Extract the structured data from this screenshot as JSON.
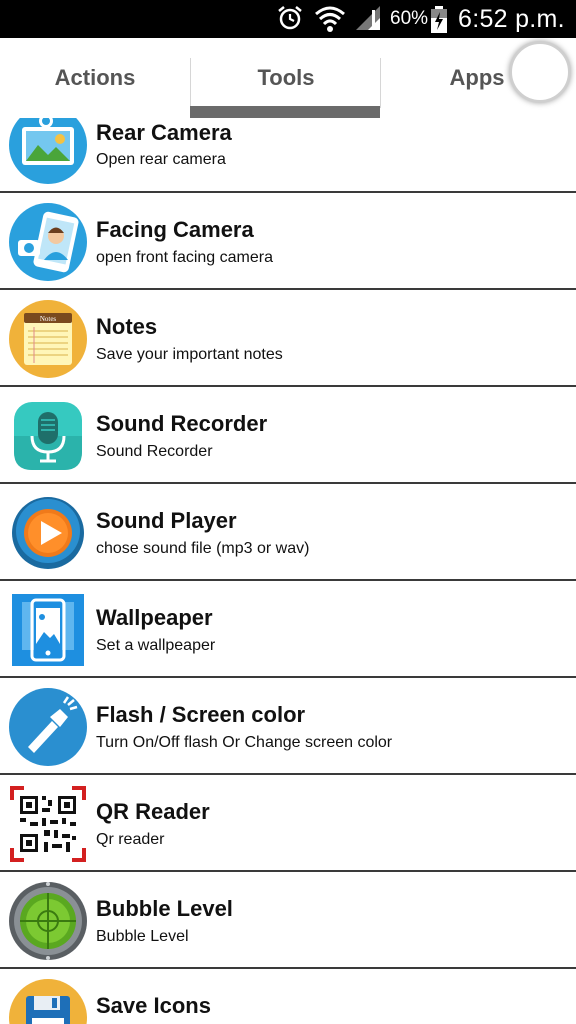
{
  "status_bar": {
    "battery_percent": "60%",
    "time": "6:52 p.m.",
    "icons": [
      "alarm-icon",
      "wifi-icon",
      "signal-icon",
      "battery-charging-icon"
    ]
  },
  "tabs": [
    {
      "label": "Actions",
      "selected": false
    },
    {
      "label": "Tools",
      "selected": true
    },
    {
      "label": "Apps",
      "selected": false
    }
  ],
  "colors": {
    "tab_indicator": "#6b6b6b",
    "icon_blue": "#2aa0dd",
    "notes_yellow": "#f0b23a"
  },
  "items": [
    {
      "title": "Rear Camera",
      "subtitle": "Open rear camera",
      "icon": "rear-camera-icon"
    },
    {
      "title": "Facing Camera",
      "subtitle": "open front facing camera",
      "icon": "facing-camera-icon"
    },
    {
      "title": "Notes",
      "subtitle": "Save your important notes",
      "icon": "notes-icon"
    },
    {
      "title": "Sound Recorder",
      "subtitle": "Sound Recorder",
      "icon": "microphone-icon"
    },
    {
      "title": "Sound Player",
      "subtitle": "chose sound file (mp3 or wav)",
      "icon": "play-icon"
    },
    {
      "title": "Wallpeaper",
      "subtitle": "Set a wallpeaper",
      "icon": "wallpaper-icon"
    },
    {
      "title": "Flash / Screen color",
      "subtitle": "Turn On/Off flash Or Change screen color",
      "icon": "flashlight-icon"
    },
    {
      "title": "QR Reader",
      "subtitle": "Qr reader",
      "icon": "qr-code-icon"
    },
    {
      "title": "Bubble Level",
      "subtitle": "Bubble Level",
      "icon": "bubble-level-icon"
    },
    {
      "title": "Save Icons",
      "subtitle": "",
      "icon": "floppy-disk-icon"
    }
  ]
}
